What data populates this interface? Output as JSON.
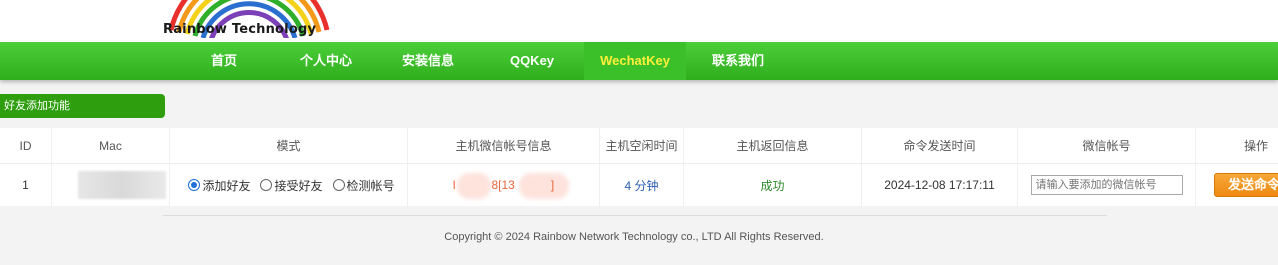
{
  "brand": {
    "logo_text": "Rainbow Technology"
  },
  "nav": {
    "items": [
      {
        "label": "首页"
      },
      {
        "label": "个人中心"
      },
      {
        "label": "安装信息"
      },
      {
        "label": "QQKey"
      },
      {
        "label": "WechatKey"
      },
      {
        "label": "联系我们"
      }
    ],
    "active": "WechatKey"
  },
  "section": {
    "title": "好友添加功能"
  },
  "table": {
    "headers": [
      "ID",
      "Mac",
      "模式",
      "主机微信帐号信息",
      "主机空闲时间",
      "主机返回信息",
      "命令发送时间",
      "微信帐号",
      "操作"
    ],
    "rows": [
      {
        "id": "1",
        "mac": "",
        "modes": [
          "添加好友",
          "接受好友",
          "检测帐号"
        ],
        "selected_mode": "添加好友",
        "host_info_prefix": "l",
        "host_info_mid": "8[13",
        "host_info_suffix": "]",
        "idle": "4 分钟",
        "result": "成功",
        "time": "2024-12-08 17:17:11",
        "wechat_placeholder": "请输入要添加的微信帐号",
        "action_label": "发送命令"
      }
    ]
  },
  "footer": {
    "text": "Copyright © 2024 Rainbow Network Technology co., LTD All Rights Reserved."
  },
  "colors": {
    "nav": "#3cc02a",
    "nav_active_text": "#ffef3a",
    "tag": "#2e9e0e",
    "button": "#f39a20"
  }
}
